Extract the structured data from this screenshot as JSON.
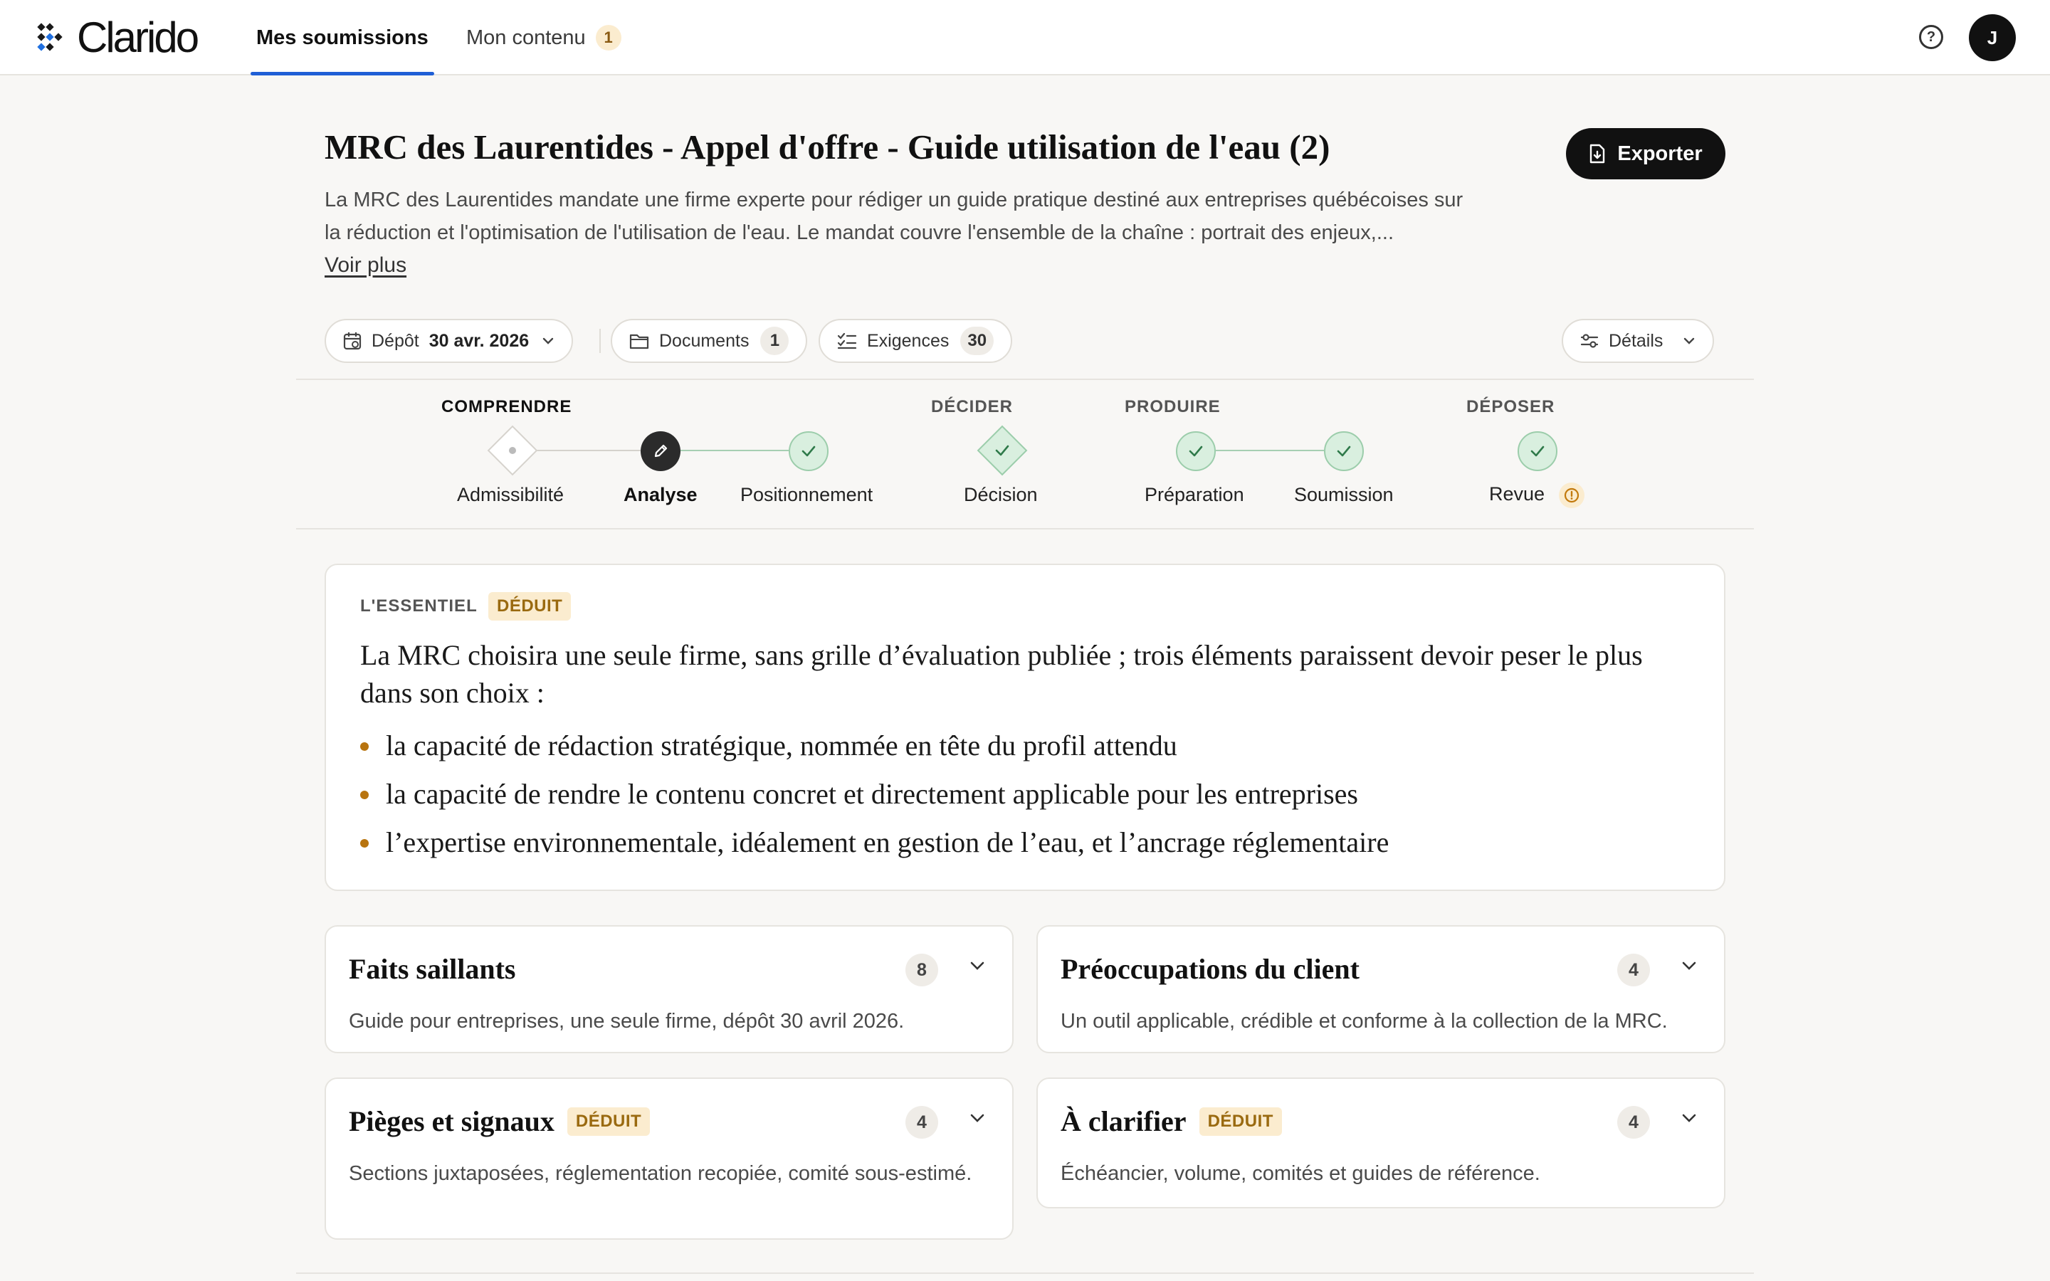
{
  "app": {
    "logo_text": "Clarido",
    "avatar_initial": "J"
  },
  "nav": {
    "tabs": [
      {
        "label": "Mes soumissions",
        "active": true
      },
      {
        "label": "Mon contenu",
        "badge": "1",
        "active": false
      }
    ],
    "help_icon": "question-circle-icon"
  },
  "header": {
    "title": "MRC des Laurentides - Appel d'offre - Guide utilisation de l'eau (2)",
    "description": "La MRC des Laurentides mandate une firme experte pour rédiger un guide pratique destiné aux entreprises québécoises sur la réduction et l'optimisation de l'utilisation de l'eau. Le mandat couvre l'ensemble de la chaîne : portrait des enjeux,...",
    "see_more": "Voir plus",
    "export_label": "Exporter"
  },
  "pills": {
    "deposit_label": "Dépôt",
    "deposit_value": "30 avr. 2026",
    "documents_label": "Documents",
    "documents_count": "1",
    "requirements_label": "Exigences",
    "requirements_count": "30",
    "details_label": "Détails"
  },
  "stepper": {
    "phases": [
      "COMPRENDRE",
      "DÉCIDER",
      "PRODUIRE",
      "DÉPOSER"
    ],
    "steps": [
      {
        "label": "Admissibilité",
        "status": "pending"
      },
      {
        "label": "Analyse",
        "status": "current"
      },
      {
        "label": "Positionnement",
        "status": "done"
      },
      {
        "label": "Décision",
        "status": "done"
      },
      {
        "label": "Préparation",
        "status": "done"
      },
      {
        "label": "Soumission",
        "status": "done"
      },
      {
        "label": "Revue",
        "status": "done",
        "warning": true
      }
    ]
  },
  "essentiel": {
    "eyebrow": "L'ESSENTIEL",
    "tag": "DÉDUIT",
    "lead": "La MRC choisira une seule firme, sans grille d’évaluation publiée ; trois éléments paraissent devoir peser le plus dans son choix :",
    "points": [
      "la capacité de rédaction stratégique, nommée en tête du profil attendu",
      "la capacité de rendre le contenu concret et directement applicable pour les entreprises",
      "l’expertise environnementale, idéalement en gestion de l’eau, et l’ancrage réglementaire"
    ]
  },
  "sections": [
    {
      "title": "Faits saillants",
      "tag": "",
      "count": "8",
      "description": "Guide pour entreprises, une seule firme, dépôt 30 avril 2026."
    },
    {
      "title": "Préoccupations du client",
      "tag": "",
      "count": "4",
      "description": "Un outil applicable, crédible et conforme à la collection de la MRC."
    },
    {
      "title": "Pièges et signaux",
      "tag": "DÉDUIT",
      "count": "4",
      "description": "Sections juxtaposées, réglementation recopiée, comité sous-estimé."
    },
    {
      "title": "À clarifier",
      "tag": "DÉDUIT",
      "count": "4",
      "description": "Échéancier, volume, comités et guides de référence."
    }
  ],
  "colors": {
    "accent": "#1f5fd6",
    "tag_bg": "#fbeccf",
    "tag_text": "#9a6a10",
    "done_green": "#d9efdf"
  }
}
